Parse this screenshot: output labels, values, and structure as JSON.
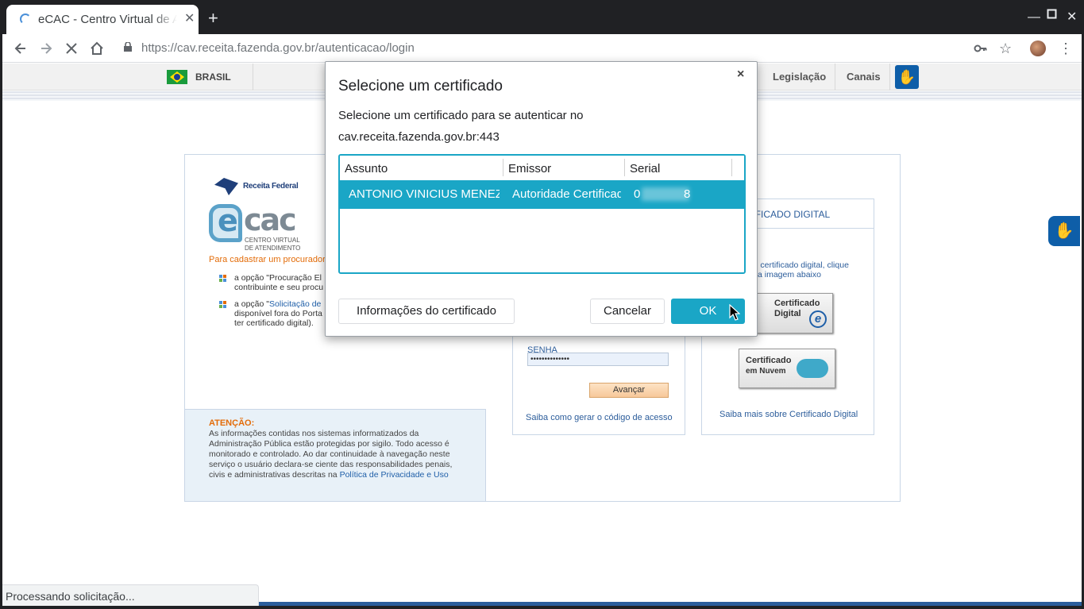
{
  "browser": {
    "tab_title": "eCAC - Centro Virtual de Atendimento",
    "tab_close": "✕",
    "new_tab": "+",
    "url_host": "https://cav.receita.fazenda.gov.br",
    "url_path": "/autenticacao/login",
    "status_text": "Processando solicitação..."
  },
  "govbar": {
    "country": "BRASIL",
    "links": [
      "Legislação",
      "Canais"
    ]
  },
  "page": {
    "rf_logo_text": "Receita Federal",
    "ecac_cac": "cac",
    "ecac_sub1": "CENTRO VIRTUAL",
    "ecac_sub2": "DE ATENDIMENTO",
    "cadastrar": "Para cadastrar um procurador",
    "bullet1_line1": "a opção \"Procuração El",
    "bullet1_line2": "contribuinte e seu procu",
    "bullet2_line1_a": "a opção \"",
    "bullet2_line1_link": "Solicitação de",
    "bullet2_line2": "disponível fora do Porta",
    "bullet2_line3": "ter certificado digital).",
    "attention_head": "ATENÇÃO:",
    "attention_body": "As informações contidas nos sistemas informatizados da Administração Pública estão protegidas por sigilo. Todo acesso é monitorado e controlado. Ao dar continuidade à navegação neste serviço o usuário declara-se ciente das responsabilidades penais, civis e administrativas descritas na ",
    "attention_link": "Política de Privacidade e Uso",
    "senha_label": "SENHA",
    "senha_value": "••••••••••••••",
    "avancar": "Avançar",
    "saiba_codigo": "Saiba como gerar o código de acesso",
    "cert_head": "TIFICADO DIGITAL",
    "cert_txt1": "ossui certificado digital, clique",
    "cert_txt2": "a imagem abaixo",
    "cert_img1_line1": "Certificado",
    "cert_img1_line2": "Digital",
    "cert_img2_line1": "Certificado",
    "cert_img2_line2": "em Nuvem",
    "saiba_cert": "Saiba mais sobre Certificado Digital"
  },
  "dialog": {
    "title": "Selecione um certificado",
    "close": "×",
    "desc_line1": "Selecione um certificado para se autenticar no",
    "desc_line2": "cav.receita.fazenda.gov.br:443",
    "columns": [
      "Assunto",
      "Emissor",
      "Serial"
    ],
    "rows": [
      {
        "assunto": "ANTONIO VINICIUS MENEZES",
        "emissor": "Autoridade Certificadora",
        "serial_start": "0",
        "serial_end": "8"
      }
    ],
    "info_button": "Informações do certificado",
    "cancel_button": "Cancelar",
    "ok_button": "OK"
  },
  "colors": {
    "accent": "#1aa6c6",
    "title_bar": "#202124",
    "link": "#2c5d9b",
    "warning": "#e36c09"
  }
}
